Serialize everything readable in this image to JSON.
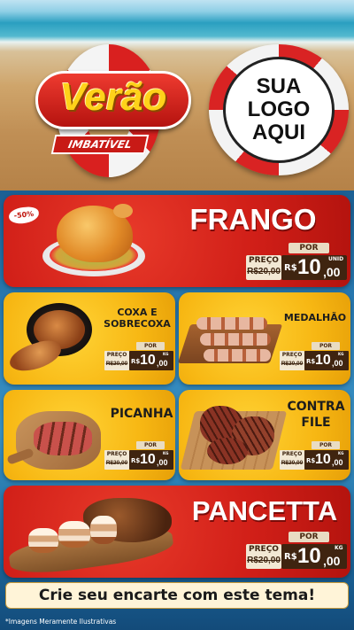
{
  "header": {
    "headline": "Verão",
    "subheadline": "IMBATÍVEL",
    "logo_placeholder": [
      "SUA",
      "LOGO",
      "AQUI"
    ]
  },
  "products": [
    {
      "name": "FRANGO",
      "badge": "-50%",
      "label_por": "POR",
      "label_preco": "PREÇO",
      "old_price": "R$20,00",
      "prefix": "R$",
      "price": "10",
      "cents": ",00",
      "unit": "UNID"
    },
    {
      "name": "COXA E SOBRECOXA",
      "label_por": "POR",
      "label_preco": "PREÇO",
      "old_price": "R$20,00",
      "prefix": "R$",
      "price": "10",
      "cents": ",00",
      "unit": "KG"
    },
    {
      "name": "MEDALHÃO",
      "label_por": "POR",
      "label_preco": "PREÇO",
      "old_price": "R$20,00",
      "prefix": "R$",
      "price": "10",
      "cents": ",00",
      "unit": "KG"
    },
    {
      "name": "PICANHA",
      "label_por": "POR",
      "label_preco": "PREÇO",
      "old_price": "R$20,00",
      "prefix": "R$",
      "price": "10",
      "cents": ",00",
      "unit": "KG"
    },
    {
      "name": "CONTRA FILE",
      "label_por": "POR",
      "label_preco": "PREÇO",
      "old_price": "R$20,00",
      "prefix": "R$",
      "price": "10",
      "cents": ",00",
      "unit": "KG"
    },
    {
      "name": "PANCETTA",
      "label_por": "POR",
      "label_preco": "PREÇO",
      "old_price": "R$20,00",
      "prefix": "R$",
      "price": "10",
      "cents": ",00",
      "unit": "KG"
    }
  ],
  "footer": {
    "cta": "Crie seu encarte com este tema!",
    "note": "*Imagens Meramente Ilustrativas"
  },
  "colors": {
    "red": "#d11f18",
    "yellow": "#f7b713",
    "price_dark": "#3f2410",
    "ocean": "#2a7db5"
  }
}
